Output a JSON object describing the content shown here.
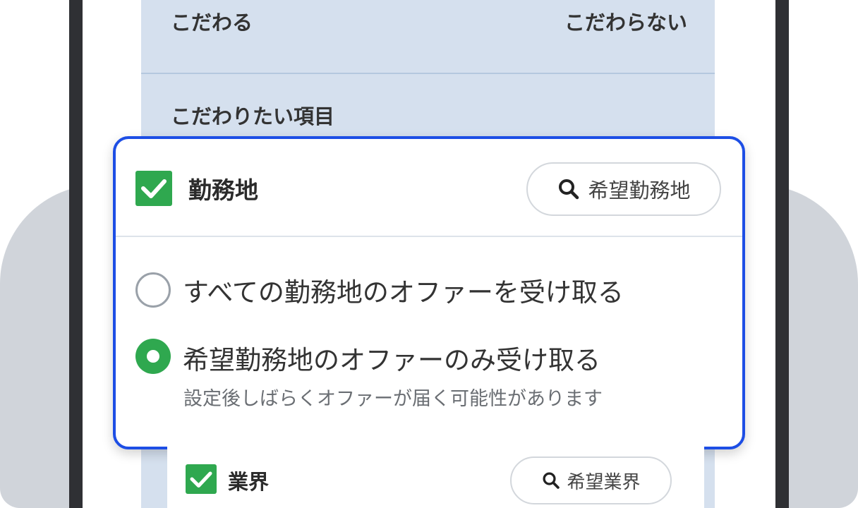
{
  "preference": {
    "left_label": "こだわる",
    "right_label": "こだわらない"
  },
  "section": {
    "title": "こだわりたい項目"
  },
  "work_location": {
    "title": "勤務地",
    "checked": true,
    "search_button_label": "希望勤務地",
    "options": [
      {
        "label": "すべての勤務地のオファーを受け取る",
        "selected": false
      },
      {
        "label": "希望勤務地のオファーのみ受け取る",
        "selected": true,
        "note": "設定後しばらくオファーが届く可能性があります"
      }
    ]
  },
  "industry": {
    "title": "業界",
    "checked": true,
    "search_button_label": "希望業界"
  },
  "colors": {
    "highlight_border": "#1d4ee5",
    "check_green": "#2fa84f",
    "panel_blue": "#d5e0ee",
    "phone_frame": "#2f3034"
  },
  "icons": {
    "search": "search-icon",
    "check": "checkmark-icon"
  }
}
